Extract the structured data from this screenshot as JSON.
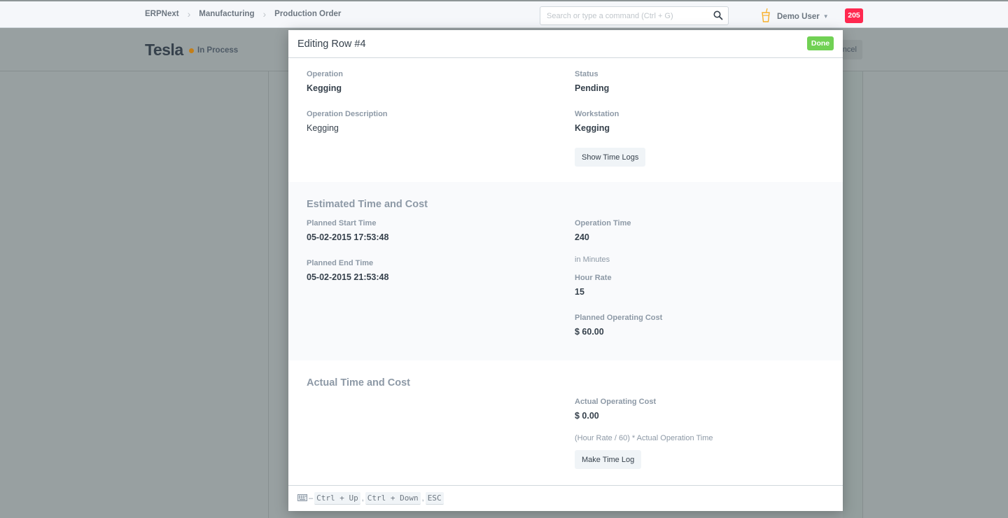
{
  "navbar": {
    "breadcrumbs": [
      "ERPNext",
      "Manufacturing",
      "Production Order"
    ],
    "search_placeholder": "Search or type a command (Ctrl + G)",
    "user_name": "Demo User",
    "notification_count": "205"
  },
  "page": {
    "title": "Tesla",
    "status": "In Process",
    "status_color": "#c47e17",
    "cancel_label": "Cancel"
  },
  "modal": {
    "title": "Editing Row #4",
    "done_label": "Done",
    "details": {
      "operation_label": "Operation",
      "operation_value": "Kegging",
      "description_label": "Operation Description",
      "description_value": "Kegging",
      "status_label": "Status",
      "status_value": "Pending",
      "workstation_label": "Workstation",
      "workstation_value": "Kegging",
      "show_time_logs_label": "Show Time Logs"
    },
    "estimated": {
      "heading": "Estimated Time and Cost",
      "planned_start_label": "Planned Start Time",
      "planned_start_value": "05-02-2015 17:53:48",
      "planned_end_label": "Planned End Time",
      "planned_end_value": "05-02-2015 21:53:48",
      "operation_time_label": "Operation Time",
      "operation_time_value": "240",
      "operation_time_help": "in Minutes",
      "hour_rate_label": "Hour Rate",
      "hour_rate_value": "15",
      "planned_cost_label": "Planned Operating Cost",
      "planned_cost_value": "$ 60.00"
    },
    "actual": {
      "heading": "Actual Time and Cost",
      "actual_cost_label": "Actual Operating Cost",
      "actual_cost_value": "$ 0.00",
      "actual_cost_help": "(Hour Rate / 60) * Actual Operation Time",
      "make_time_log_label": "Make Time Log"
    },
    "footer": {
      "shortcuts": [
        "Ctrl + Up",
        "Ctrl + Down",
        "ESC"
      ]
    }
  }
}
